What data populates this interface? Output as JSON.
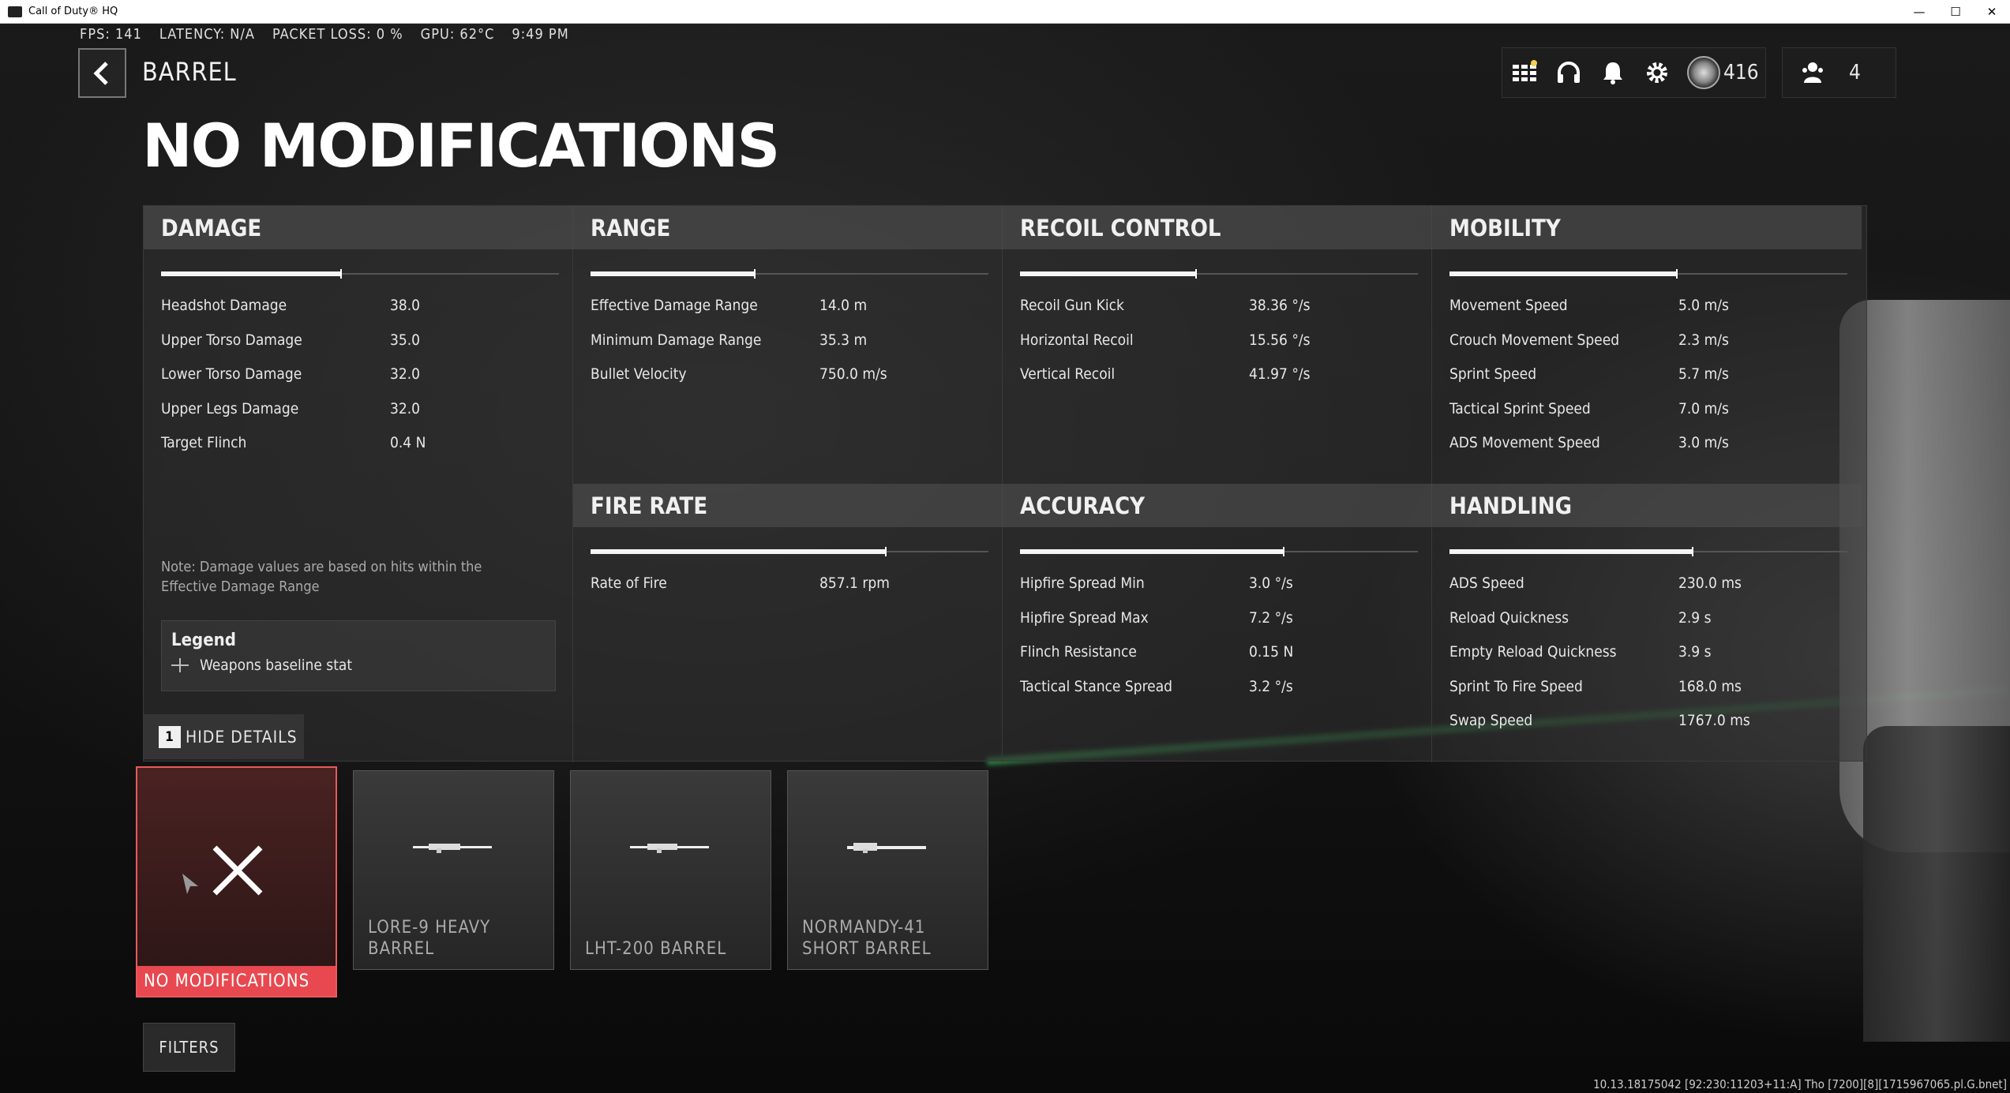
{
  "window": {
    "title": "Call of Duty® HQ"
  },
  "perf": {
    "fps": "FPS: 141",
    "latency": "LATENCY: N/A",
    "packet_loss": "PACKET LOSS: 0 %",
    "gpu": "GPU: 62°C",
    "time": "9:49 PM"
  },
  "header": {
    "subtitle": "BARREL",
    "title": "NO MODIFICATIONS",
    "prestige_level": "416",
    "party_count": "4"
  },
  "sections": {
    "damage": {
      "title": "DAMAGE",
      "bar": 0.45,
      "rows": [
        {
          "name": "Headshot Damage",
          "value": "38.0"
        },
        {
          "name": "Upper Torso Damage",
          "value": "35.0"
        },
        {
          "name": "Lower Torso Damage",
          "value": "32.0"
        },
        {
          "name": "Upper Legs Damage",
          "value": "32.0"
        },
        {
          "name": "Target Flinch",
          "value": "0.4 N"
        }
      ],
      "note": "Note: Damage values are based on hits within the Effective Damage Range"
    },
    "range": {
      "title": "RANGE",
      "bar": 0.41,
      "rows": [
        {
          "name": "Effective Damage Range",
          "value": "14.0 m"
        },
        {
          "name": "Minimum Damage Range",
          "value": "35.3 m"
        },
        {
          "name": "Bullet Velocity",
          "value": "750.0 m/s"
        }
      ]
    },
    "recoil": {
      "title": "RECOIL CONTROL",
      "bar": 0.44,
      "rows": [
        {
          "name": "Recoil Gun Kick",
          "value": "38.36 °/s"
        },
        {
          "name": "Horizontal Recoil",
          "value": "15.56 °/s"
        },
        {
          "name": "Vertical Recoil",
          "value": "41.97 °/s"
        }
      ]
    },
    "mobility": {
      "title": "MOBILITY",
      "bar": 0.57,
      "rows": [
        {
          "name": "Movement Speed",
          "value": "5.0 m/s"
        },
        {
          "name": "Crouch Movement Speed",
          "value": "2.3 m/s"
        },
        {
          "name": "Sprint Speed",
          "value": "5.7 m/s"
        },
        {
          "name": "Tactical Sprint Speed",
          "value": "7.0 m/s"
        },
        {
          "name": "ADS Movement Speed",
          "value": "3.0 m/s"
        }
      ]
    },
    "fire_rate": {
      "title": "FIRE RATE",
      "bar": 0.74,
      "rows": [
        {
          "name": "Rate of Fire",
          "value": "857.1 rpm"
        }
      ]
    },
    "accuracy": {
      "title": "ACCURACY",
      "bar": 0.66,
      "rows": [
        {
          "name": "Hipfire Spread Min",
          "value": "3.0 °/s"
        },
        {
          "name": "Hipfire Spread Max",
          "value": "7.2 °/s"
        },
        {
          "name": "Flinch Resistance",
          "value": "0.15 N"
        },
        {
          "name": "Tactical Stance Spread",
          "value": "3.2 °/s"
        }
      ]
    },
    "handling": {
      "title": "HANDLING",
      "bar": 0.61,
      "rows": [
        {
          "name": "ADS Speed",
          "value": "230.0 ms"
        },
        {
          "name": "Reload Quickness",
          "value": "2.9 s"
        },
        {
          "name": "Empty Reload Quickness",
          "value": "3.9 s"
        },
        {
          "name": "Sprint To Fire Speed",
          "value": "168.0 ms"
        },
        {
          "name": "Swap Speed",
          "value": "1767.0 ms"
        }
      ]
    }
  },
  "legend": {
    "title": "Legend",
    "item": "Weapons baseline stat"
  },
  "hide_details": {
    "key": "1",
    "label": "HIDE DETAILS"
  },
  "attachments": [
    {
      "label": "NO MODIFICATIONS",
      "icon": "close-icon",
      "selected": true
    },
    {
      "label": "LORE-9 HEAVY BARREL",
      "icon": "rifle-icon"
    },
    {
      "label": "LHT-200 BARREL",
      "icon": "rifle-icon"
    },
    {
      "label": "NORMANDY-41 SHORT BARREL",
      "icon": "rifle-icon"
    }
  ],
  "filters_label": "FILTERS",
  "footer": "10.13.18175042 [92:230:11203+11:A] Tho [7200][8][1715967065.pl.G.bnet]"
}
